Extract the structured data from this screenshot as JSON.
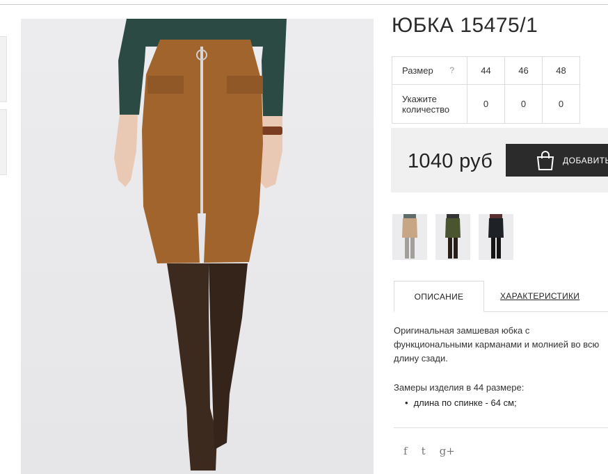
{
  "product": {
    "title": "ЮБКА 15475/1",
    "price": "1040 руб",
    "add_to_cart_label": "ДОБАВИТЬ"
  },
  "size_table": {
    "size_label": "Размер",
    "help_mark": "?",
    "sizes": [
      "44",
      "46",
      "48"
    ],
    "quantity_label": "Укажите количество",
    "quantities": [
      "0",
      "0",
      "0"
    ]
  },
  "tabs": {
    "description": "ОПИСАНИЕ",
    "characteristics": "ХАРАКТЕРИСТИКИ"
  },
  "description": {
    "text": "Оригинальная замшевая юбка с функциональными карманами и молнией во всю длину сзади.",
    "measures_title": "Замеры изделия в 44 размере:",
    "measures": [
      "длина по спинке - 64 см;"
    ]
  },
  "social": {
    "facebook": "f",
    "twitter": "t",
    "googleplus": "g+"
  },
  "colors": {
    "skirt": "#a0642c",
    "boots": "#3d2a1f",
    "sweater": "#2c4a44",
    "button": "#2b2b2b",
    "price_bg": "#f0f0f0"
  },
  "icons": {
    "cart": "shopping-bag-icon",
    "facebook": "facebook-icon",
    "twitter": "twitter-icon",
    "googleplus": "google-plus-icon"
  }
}
